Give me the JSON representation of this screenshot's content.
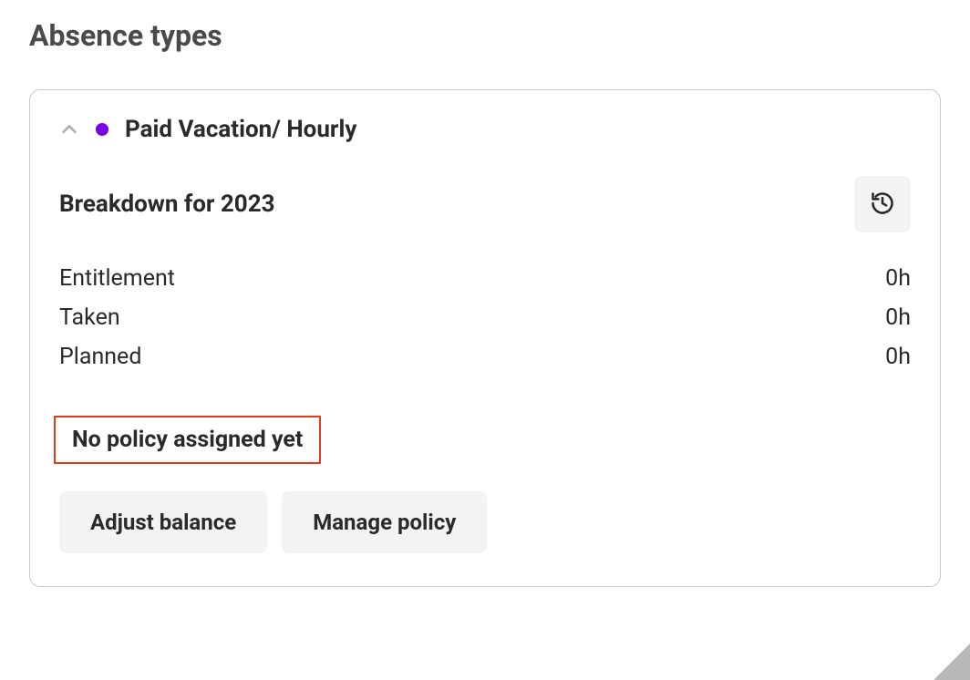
{
  "page": {
    "title": "Absence types"
  },
  "card": {
    "typeName": "Paid Vacation/ Hourly",
    "breakdownTitle": "Breakdown for 2023",
    "dotColor": "#7a00e6",
    "stats": {
      "entitlement": {
        "label": "Entitlement",
        "value": "0h"
      },
      "taken": {
        "label": "Taken",
        "value": "0h"
      },
      "planned": {
        "label": "Planned",
        "value": "0h"
      }
    },
    "policyStatus": "No policy assigned yet",
    "buttons": {
      "adjustBalance": "Adjust balance",
      "managePolicy": "Manage policy"
    }
  }
}
